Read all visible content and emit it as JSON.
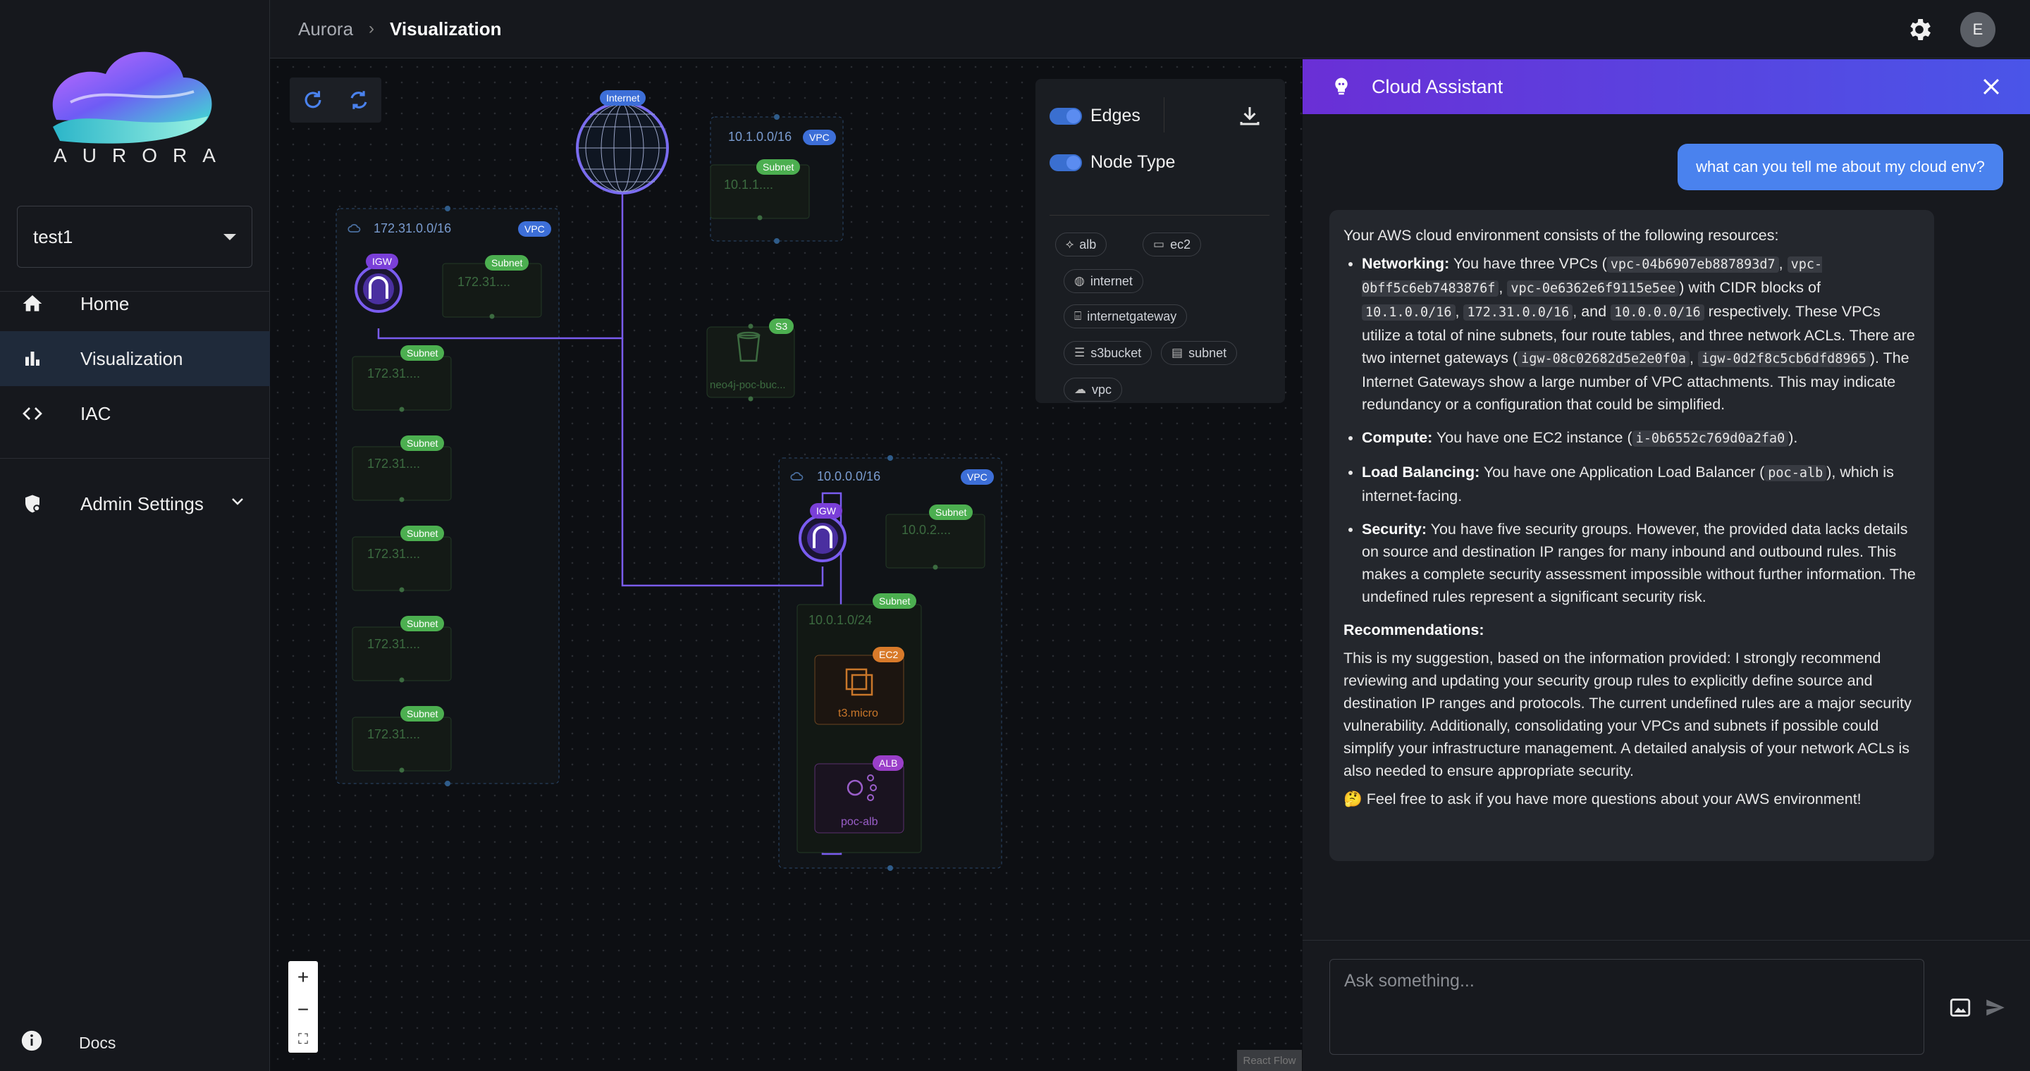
{
  "sidebar": {
    "logo_text": "AURORA",
    "project": "test1",
    "nav": [
      {
        "label": "Home",
        "icon": "home-icon"
      },
      {
        "label": "Visualization",
        "icon": "bar-chart-icon"
      },
      {
        "label": "IAC",
        "icon": "code-icon"
      }
    ],
    "admin_label": "Admin Settings",
    "docs_label": "Docs"
  },
  "header": {
    "breadcrumb_root": "Aurora",
    "breadcrumb_current": "Visualization",
    "avatar_initial": "E"
  },
  "canvas": {
    "watermark": "React Flow",
    "legend": {
      "edges_label": "Edges",
      "node_type_label": "Node Type",
      "chips": [
        "alb",
        "ec2",
        "internet",
        "internetgateway",
        "s3bucket",
        "subnet",
        "vpc"
      ]
    },
    "nodes": {
      "internet": "Internet",
      "vpc_badge": "VPC",
      "igw_badge": "IGW",
      "subnet_badge": "Subnet",
      "s3_badge": "S3",
      "ec2_badge": "EC2",
      "alb_badge": "ALB",
      "vpc1_cidr": "172.31.0.0/16",
      "vpc2_cidr": "10.1.0.0/16",
      "vpc3_cidr": "10.0.0.0/16",
      "subnet_short_172": "172.31....",
      "subnet_short_101": "10.1.1....",
      "subnet_short_102": "10.0.2....",
      "subnet_1024": "10.0.1.0/24",
      "s3_name": "neo4j-poc-buc...",
      "ec2_name": "t3.micro",
      "alb_name": "poc-alb"
    }
  },
  "chat": {
    "title": "Cloud Assistant",
    "user_message": "what can you tell me about my cloud env?",
    "intro": "Your AWS cloud environment consists of the following resources:",
    "networking_label": "Networking:",
    "networking_t1": " You have three VPCs (",
    "vpc_a": "vpc-04b6907eb887893d7",
    "vpc_b": "vpc-0bff5c6eb7483876f",
    "vpc_c": "vpc-0e6362e6f9115e5ee",
    "networking_t2": ") with CIDR blocks of ",
    "cidr_a": "10.1.0.0/16",
    "cidr_b": "172.31.0.0/16",
    "cidr_c": "10.0.0.0/16",
    "networking_t3": " respectively. These VPCs utilize a total of nine subnets, four route tables, and three network ACLs. There are two internet gateways (",
    "igw_a": "igw-08c02682d5e2e0f0a",
    "igw_b": "igw-0d2f8c5cb6dfd8965",
    "networking_t4": "). The Internet Gateways show a large number of VPC attachments. This may indicate redundancy or a configuration that could be simplified.",
    "compute_label": "Compute:",
    "compute_t1": " You have one EC2 instance (",
    "ec2_id": "i-0b6552c769d0a2fa0",
    "compute_t2": ").",
    "lb_label": "Load Balancing:",
    "lb_t1": " You have one Application Load Balancer (",
    "alb_id": "poc-alb",
    "lb_t2": "), which is internet-facing.",
    "security_label": "Security:",
    "security_text": " You have five security groups. However, the provided data lacks details on source and destination IP ranges for many inbound and outbound rules. This makes a complete security assessment impossible without further information. The undefined rules represent a significant security risk.",
    "recommend_label": "Recommendations:",
    "recommend_text": "This is my suggestion, based on the information provided: I strongly recommend reviewing and updating your security group rules to explicitly define source and destination IP ranges and protocols. The current undefined rules are a major security vulnerability. Additionally, consolidating your VPCs and subnets if possible could simplify your infrastructure management. A detailed analysis of your network ACLs is also needed to ensure appropriate security.",
    "closing": "🤔 Feel free to ask if you have more questions about your AWS environment!",
    "input_placeholder": "Ask something...",
    "colors": {
      "header_start": "#6a2fd6",
      "header_end": "#4a55e8",
      "user_bubble": "#4a82ee"
    }
  }
}
